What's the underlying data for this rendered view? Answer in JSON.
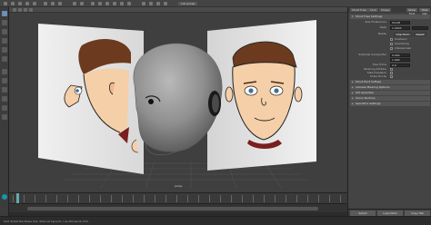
{
  "viewport": {
    "camera_label": "persp",
    "panel_label": "ncil pones"
  },
  "attribute_editor": {
    "tabs": [
      "Shrat Fuse",
      "CLUI",
      "Shape"
    ],
    "top_buttons": [
      "Show Foot",
      "Hide Gst"
    ],
    "rows": [
      {
        "label": "Size Finalisonce",
        "value": "Shraft"
      },
      {
        "label": "Sesh",
        "value": "1.0000"
      },
      {
        "label": "Shade",
        "button": "Clip Hom",
        "button2": "Reset"
      },
      {
        "label": "",
        "check": "Incelleon"
      },
      {
        "label": "",
        "check": "Grembling"
      },
      {
        "label": "",
        "check": "Intersarrasir"
      },
      {
        "label": "Sublimel Cumperifer",
        "value": "0.000"
      },
      {
        "label": "",
        "value": "1.000"
      },
      {
        "label": "Tree Trims",
        "value": "2.0"
      },
      {
        "label": "Texemrg Dilntins",
        "value": ""
      },
      {
        "label": "Sale Fosslaion",
        "value": ""
      },
      {
        "label": "Scale Hocks",
        "value": ""
      }
    ],
    "sections": [
      "Shrut Fuse Settings",
      "Shrut Ferrt Soffuse",
      "Camess Mearing Options",
      "Shf Aerention",
      "Sirrun Nurhins",
      "Geriottrio Settings"
    ],
    "footer": [
      "Select",
      "Load Attrs",
      "Copy Tab"
    ]
  },
  "status": {
    "text": "Self. Sidiat the Sheie Siol, Shbe at Inpre fs, I ne dhinee tk ntnt."
  }
}
